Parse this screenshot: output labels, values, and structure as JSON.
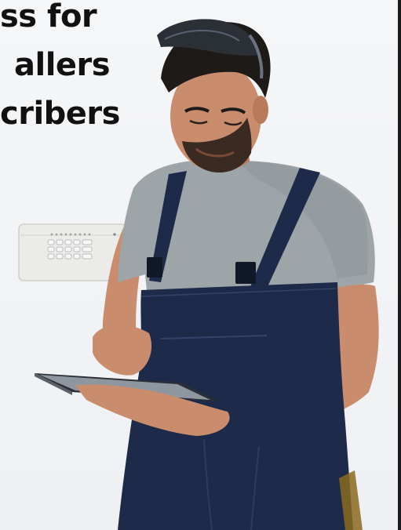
{
  "headline": {
    "line1": "ss for",
    "line2": "allers",
    "line3": "cribers"
  },
  "colors": {
    "background": "#f2f3f5",
    "overall_navy": "#1d2a4a",
    "tshirt_grey": "#9ea5a8",
    "skin": "#c98d6d",
    "hair": "#1e1a18",
    "panel": "#e9e9e6",
    "text": "#111111"
  },
  "icons": [
    "alarm-keypad-panel-icon",
    "tablet-icon",
    "safety-glasses-icon"
  ]
}
